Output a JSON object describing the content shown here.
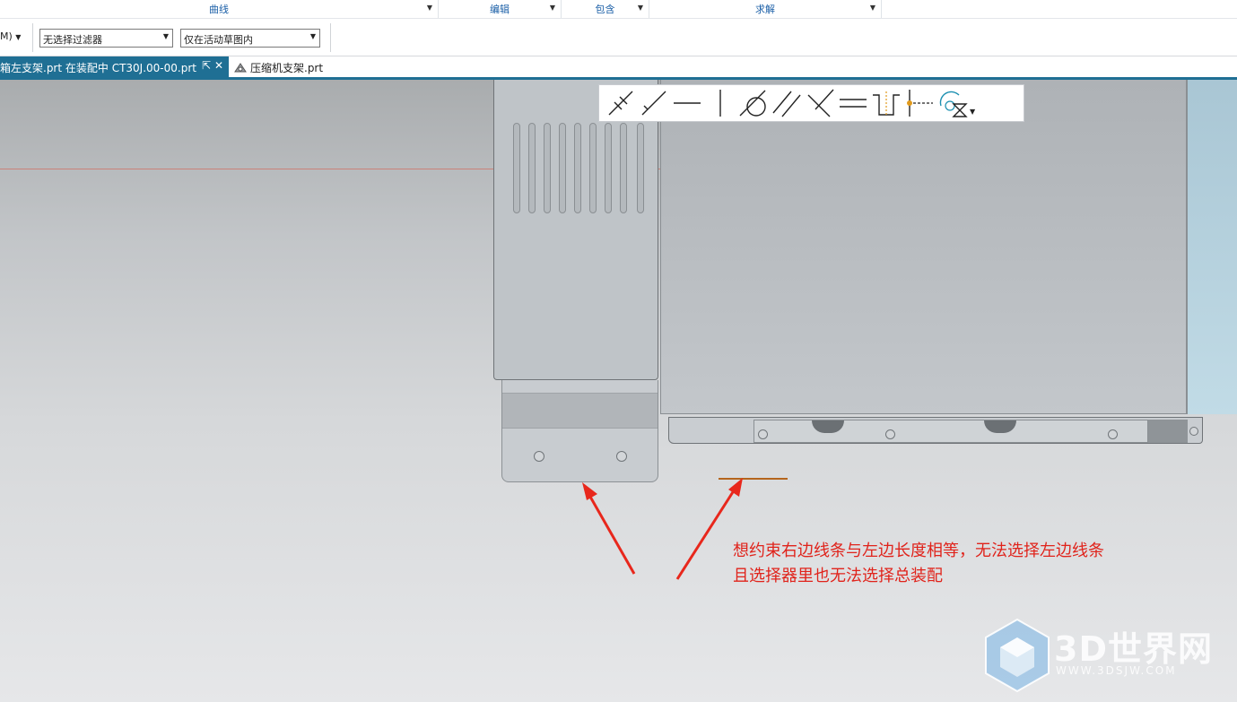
{
  "ribbon": {
    "groups": [
      {
        "label": "曲线"
      },
      {
        "label": "编辑"
      },
      {
        "label": "包含"
      },
      {
        "label": "求解"
      }
    ]
  },
  "selection_bar": {
    "menu_fragment": "M)",
    "filter_value": "无选择过滤器",
    "scope_value": "仅在活动草图内"
  },
  "tabs": [
    {
      "label": "箱左支架.prt 在装配中 CT30J.00-00.prt",
      "active": true
    },
    {
      "label": "压缩机支架.prt",
      "active": false
    }
  ],
  "constraint_toolbar": {
    "buttons": [
      "coincident-icon",
      "point-on-curve-icon",
      "horizontal-icon",
      "vertical-icon",
      "tangent-icon",
      "parallel-icon",
      "perpendicular-icon",
      "equal-length-icon",
      "midpoint-icon",
      "fixed-point-icon",
      "equal-radius-icon"
    ]
  },
  "annotation": {
    "line1": "想约束右边线条与左边长度相等，无法选择左边线条",
    "line2": "且选择器里也无法选择总装配",
    "color": "#e0231b"
  },
  "watermark": {
    "text": "3D世界网",
    "url": "WWW.3DSJW.COM"
  }
}
